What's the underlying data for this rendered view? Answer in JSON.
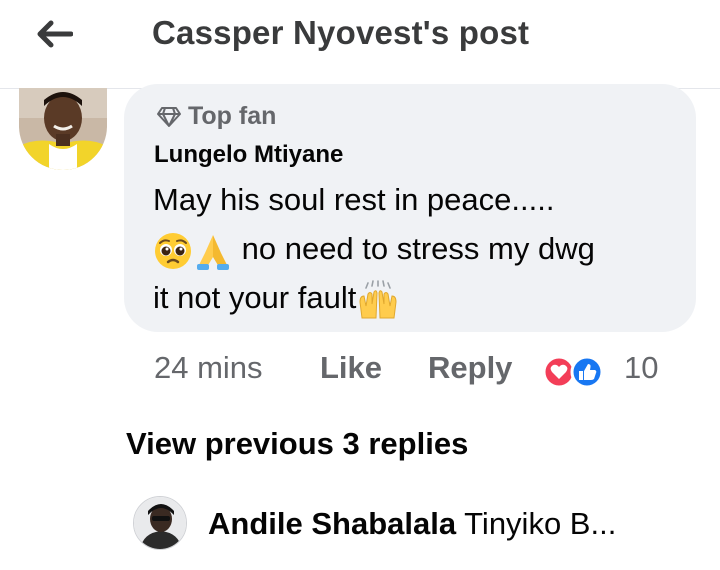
{
  "header": {
    "title": "Cassper Nyovest's post"
  },
  "comment": {
    "badge": "Top fan",
    "author": "Lungelo Mtiyane",
    "line1": "May his soul rest in peace.....",
    "line2_text": " no need to stress my dwg",
    "line3_text": "it not your fault",
    "emojis": [
      "pleading-face",
      "folded-hands",
      "raising-hands"
    ],
    "time": "24 mins",
    "like_label": "Like",
    "reply_label": "Reply",
    "reaction_types": [
      "love",
      "like"
    ],
    "reaction_count": "10"
  },
  "replies": {
    "view_previous_label": "View previous 3 replies",
    "reply_author": "Andile Shabalala",
    "reply_preview": "Tinyiko B..."
  },
  "colors": {
    "bubble": "#f0f2f5",
    "secondary_text": "#65676b",
    "love": "#f33e58",
    "like": "#1877f2"
  }
}
